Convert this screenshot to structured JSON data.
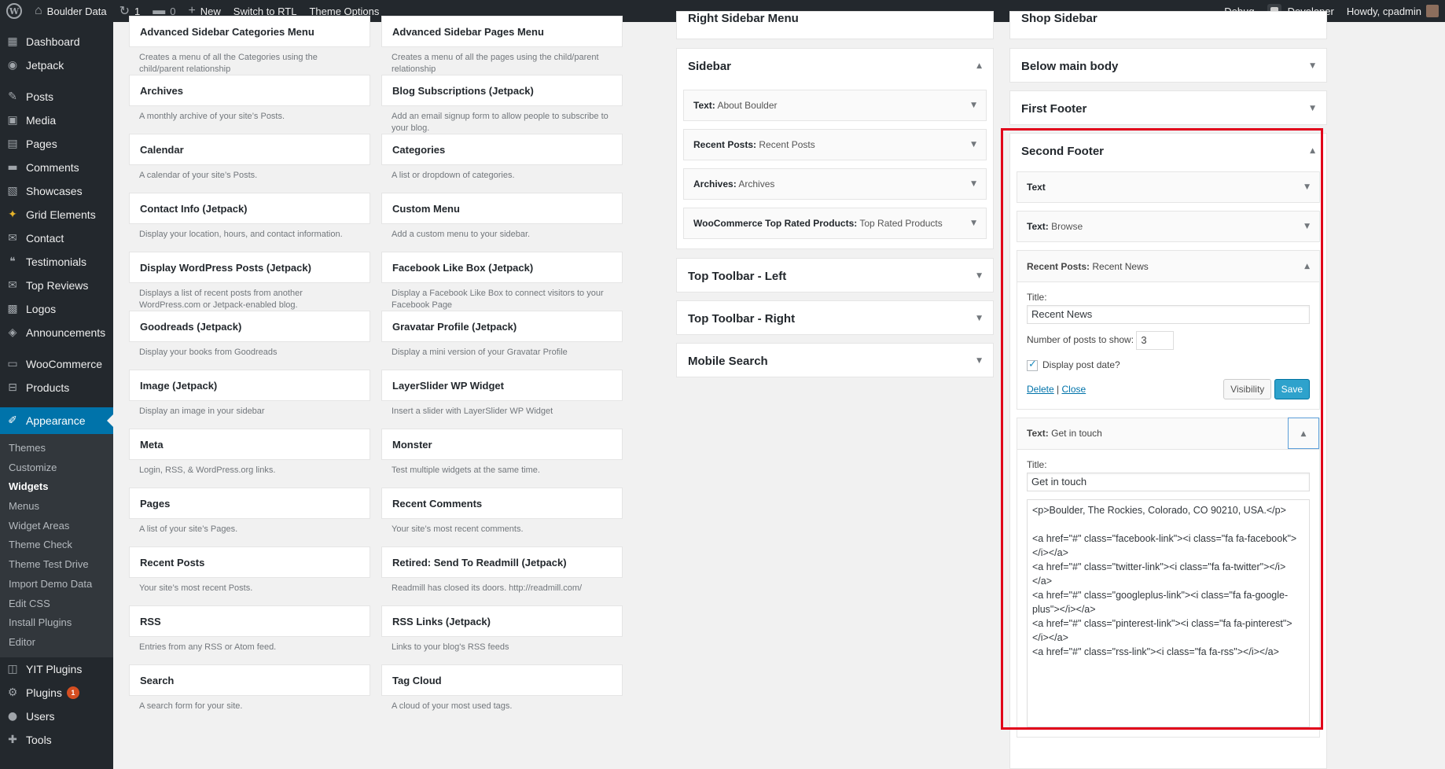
{
  "adminbar": {
    "site_name": "Boulder Data",
    "updates_count": "1",
    "comments_count": "0",
    "new_label": "New",
    "rtl_label": "Switch to RTL",
    "theme_options_label": "Theme Options",
    "debug_label": "Debug",
    "developer_label": "Developer",
    "howdy_label": "Howdy, cpadmin"
  },
  "menu": {
    "items_top": [
      {
        "label": "Dashboard",
        "icon": "▦"
      },
      {
        "label": "Jetpack",
        "icon": "◉"
      }
    ],
    "items_mid": [
      {
        "label": "Posts",
        "icon": "✎"
      },
      {
        "label": "Media",
        "icon": "▣"
      },
      {
        "label": "Pages",
        "icon": "▤"
      },
      {
        "label": "Comments",
        "icon": "▬"
      },
      {
        "label": "Showcases",
        "icon": "▧"
      },
      {
        "label": "Grid Elements",
        "icon": "✦"
      },
      {
        "label": "Contact",
        "icon": "✉"
      },
      {
        "label": "Testimonials",
        "icon": "❝"
      },
      {
        "label": "Top Reviews",
        "icon": "✉"
      },
      {
        "label": "Logos",
        "icon": "▩"
      },
      {
        "label": "Announcements",
        "icon": "◈"
      }
    ],
    "items_commerce": [
      {
        "label": "WooCommerce",
        "icon": "▭"
      },
      {
        "label": "Products",
        "icon": "⊟"
      }
    ],
    "appearance": {
      "label": "Appearance",
      "icon": "✐"
    },
    "appearance_sub": [
      {
        "label": "Themes",
        "active": false
      },
      {
        "label": "Customize",
        "active": false
      },
      {
        "label": "Widgets",
        "active": true
      },
      {
        "label": "Menus",
        "active": false
      },
      {
        "label": "Widget Areas",
        "active": false
      },
      {
        "label": "Theme Check",
        "active": false
      },
      {
        "label": "Theme Test Drive",
        "active": false
      },
      {
        "label": "Import Demo Data",
        "active": false
      },
      {
        "label": "Edit CSS",
        "active": false
      },
      {
        "label": "Install Plugins",
        "active": false
      },
      {
        "label": "Editor",
        "active": false
      }
    ],
    "items_bottom": [
      {
        "label": "YIT Plugins",
        "icon": "◫"
      },
      {
        "label": "Plugins",
        "icon": "⚙",
        "badge": "1"
      },
      {
        "label": "Users",
        "icon": "●"
      },
      {
        "label": "Tools",
        "icon": "✚"
      }
    ]
  },
  "available_widgets": {
    "left": [
      {
        "title": "Advanced Sidebar Categories Menu",
        "desc": "Creates a menu of all the Categories using the child/parent relationship"
      },
      {
        "title": "Archives",
        "desc": "A monthly archive of your site’s Posts."
      },
      {
        "title": "Calendar",
        "desc": "A calendar of your site’s Posts."
      },
      {
        "title": "Contact Info (Jetpack)",
        "desc": "Display your location, hours, and contact information."
      },
      {
        "title": "Display WordPress Posts (Jetpack)",
        "desc": "Displays a list of recent posts from another WordPress.com or Jetpack-enabled blog."
      },
      {
        "title": "Goodreads (Jetpack)",
        "desc": "Display your books from Goodreads"
      },
      {
        "title": "Image (Jetpack)",
        "desc": "Display an image in your sidebar"
      },
      {
        "title": "Meta",
        "desc": "Login, RSS, & WordPress.org links."
      },
      {
        "title": "Pages",
        "desc": "A list of your site’s Pages."
      },
      {
        "title": "Recent Posts",
        "desc": "Your site’s most recent Posts."
      },
      {
        "title": "RSS",
        "desc": "Entries from any RSS or Atom feed."
      },
      {
        "title": "Search",
        "desc": "A search form for your site."
      }
    ],
    "right": [
      {
        "title": "Advanced Sidebar Pages Menu",
        "desc": "Creates a menu of all the pages using the child/parent relationship"
      },
      {
        "title": "Blog Subscriptions (Jetpack)",
        "desc": "Add an email signup form to allow people to subscribe to your blog."
      },
      {
        "title": "Categories",
        "desc": "A list or dropdown of categories."
      },
      {
        "title": "Custom Menu",
        "desc": "Add a custom menu to your sidebar."
      },
      {
        "title": "Facebook Like Box (Jetpack)",
        "desc": "Display a Facebook Like Box to connect visitors to your Facebook Page"
      },
      {
        "title": "Gravatar Profile (Jetpack)",
        "desc": "Display a mini version of your Gravatar Profile"
      },
      {
        "title": "LayerSlider WP Widget",
        "desc": "Insert a slider with LayerSlider WP Widget"
      },
      {
        "title": "Monster",
        "desc": "Test multiple widgets at the same time."
      },
      {
        "title": "Recent Comments",
        "desc": "Your site’s most recent comments."
      },
      {
        "title": "Retired: Send To Readmill (Jetpack)",
        "desc": "Readmill has closed its doors. http://readmill.com/"
      },
      {
        "title": "RSS Links (Jetpack)",
        "desc": "Links to your blog's RSS feeds"
      },
      {
        "title": "Tag Cloud",
        "desc": "A cloud of your most used tags."
      }
    ]
  },
  "middle_col": {
    "right_sidebar_menu": "Right Sidebar Menu",
    "sidebar_title": "Sidebar",
    "sidebar_widgets": [
      {
        "type": "Text:",
        "title": "About Boulder"
      },
      {
        "type": "Recent Posts:",
        "title": "Recent Posts"
      },
      {
        "type": "Archives:",
        "title": "Archives"
      },
      {
        "type": "WooCommerce Top Rated Products:",
        "title": "Top Rated Products"
      }
    ],
    "top_toolbar_left": "Top Toolbar - Left",
    "top_toolbar_right": "Top Toolbar - Right",
    "mobile_search": "Mobile Search"
  },
  "right_col": {
    "shop_sidebar": "Shop Sidebar",
    "below_main_body": "Below main body",
    "first_footer": "First Footer",
    "second_footer": "Second Footer",
    "widgets": {
      "text1": {
        "type": "Text",
        "title": ""
      },
      "text2": {
        "type": "Text:",
        "title": "Browse"
      },
      "recent": {
        "type": "Recent Posts:",
        "title": "Recent News"
      },
      "text3": {
        "type": "Text:",
        "title": "Get in touch"
      }
    },
    "recent_form": {
      "title_label": "Title:",
      "title_value": "Recent News",
      "num_label": "Number of posts to show:",
      "num_value": "3",
      "date_label": "Display post date?",
      "delete_label": "Delete",
      "close_label": "Close",
      "visibility_label": "Visibility",
      "save_label": "Save"
    },
    "text_form": {
      "title_label": "Title:",
      "title_value": "Get in touch",
      "content": "<p>Boulder, The Rockies, Colorado, CO 90210, USA.</p>\n\n<a href=\"#\" class=\"facebook-link\"><i class=\"fa fa-facebook\"></i></a>\n<a href=\"#\" class=\"twitter-link\"><i class=\"fa fa-twitter\"></i></a>\n<a href=\"#\" class=\"googleplus-link\"><i class=\"fa fa-google-plus\"></i></a>\n<a href=\"#\" class=\"pinterest-link\"><i class=\"fa fa-pinterest\"></i></a>\n<a href=\"#\" class=\"rss-link\"><i class=\"fa fa-rss\"></i></a>"
    }
  },
  "colors": {
    "accent": "#0073aa",
    "highlight": "#e1001a",
    "adminbar": "#23282d"
  }
}
